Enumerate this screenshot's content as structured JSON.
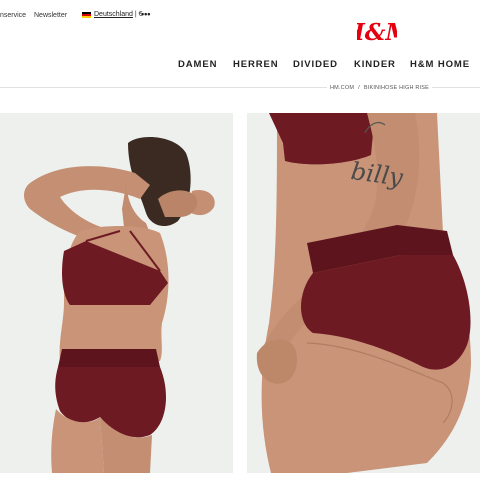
{
  "topbar": {
    "customer_service": "nservice",
    "newsletter": "Newsletter",
    "country": "Deutschland",
    "currency": "| €",
    "more": "•••"
  },
  "brand": {
    "logo_text": "H&M",
    "color": "#e50010"
  },
  "nav": {
    "items": [
      "DAMEN",
      "HERREN",
      "DIVIDED",
      "KINDER",
      "H&M HOME"
    ]
  },
  "breadcrumb": {
    "items": [
      "HM.COM",
      "BIKINIHOSE HIGH RISE"
    ],
    "separator": "/"
  },
  "product": {
    "swimwear_color": "#6e1a22",
    "tattoo_text": "billy"
  }
}
